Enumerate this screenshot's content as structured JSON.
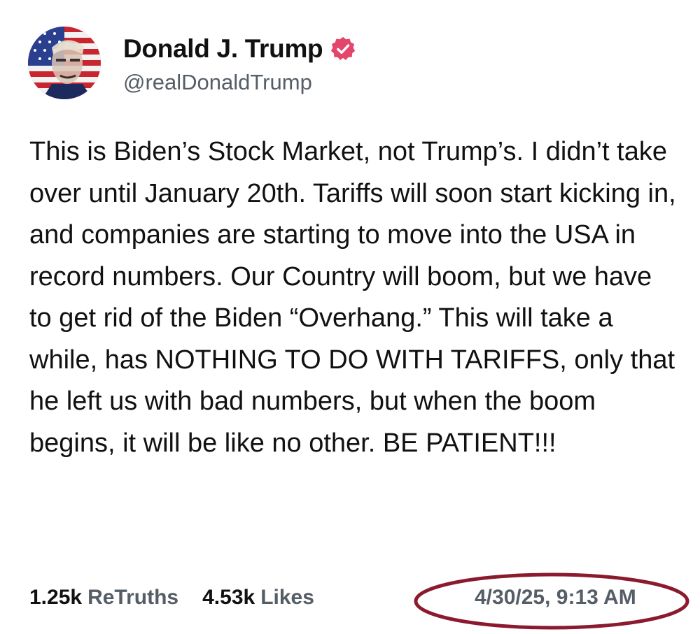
{
  "author": {
    "display_name": "Donald J. Trump",
    "handle": "@realDonaldTrump",
    "verified": true
  },
  "post": {
    "text": "This is Biden’s Stock Market, not Trump’s. I didn’t take over until January 20th. Tariffs will soon start kicking in, and companies are starting to move into the USA in record numbers. Our Country will boom, but we have to get rid of the Biden “Overhang.” This will take a while, has NOTHING TO DO WITH TARIFFS, only that he left us with bad numbers, but when the boom begins, it will be like no other. BE PATIENT!!!"
  },
  "stats": {
    "retruths_count": "1.25k",
    "retruths_label": "ReTruths",
    "likes_count": "4.53k",
    "likes_label": "Likes"
  },
  "timestamp": "4/30/25, 9:13 AM",
  "colors": {
    "verified_badge": "#e3456b",
    "highlight_ellipse": "#8b1a2e",
    "secondary_text": "#555d66"
  },
  "icons": {
    "verified": "verified-badge-icon",
    "avatar": "flag-portrait-avatar"
  }
}
